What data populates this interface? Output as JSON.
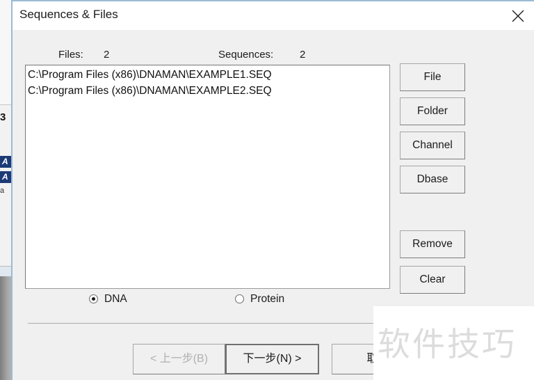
{
  "window": {
    "title": "Sequences & Files",
    "close_icon": "close-icon"
  },
  "header": {
    "files_label": "Files:",
    "files_value": "2",
    "sequences_label": "Sequences:",
    "sequences_value": "2"
  },
  "file_list": {
    "items": [
      "C:\\Program Files (x86)\\DNAMAN\\EXAMPLE1.SEQ",
      "C:\\Program Files (x86)\\DNAMAN\\EXAMPLE2.SEQ"
    ]
  },
  "side_buttons": {
    "file": "File",
    "folder": "Folder",
    "channel": "Channel",
    "dbase": "Dbase",
    "remove": "Remove",
    "clear": "Clear"
  },
  "sequence_type": {
    "dna_label": "DNA",
    "protein_label": "Protein",
    "selected": "DNA"
  },
  "navigation": {
    "back_label": "< 上一步(B)",
    "next_label": "下一步(N) >",
    "cancel_label": "取消"
  },
  "watermark": {
    "text": "软件技巧"
  },
  "background": {
    "fragment_char": "3",
    "selected_row_1": "A",
    "selected_row_2": "A",
    "plain_row": "a"
  },
  "colors": {
    "dialog_background": "#f0f0f0",
    "title_bar": "#ffffff",
    "dialog_border": "#9bbbd4",
    "list_background": "#ffffff",
    "button_face": "#f0f0f0",
    "text": "#1b1b1b",
    "disabled_text": "#b0b0b0",
    "watermark_text": "#dcdcdc",
    "selection_blue": "#1c3a76"
  }
}
